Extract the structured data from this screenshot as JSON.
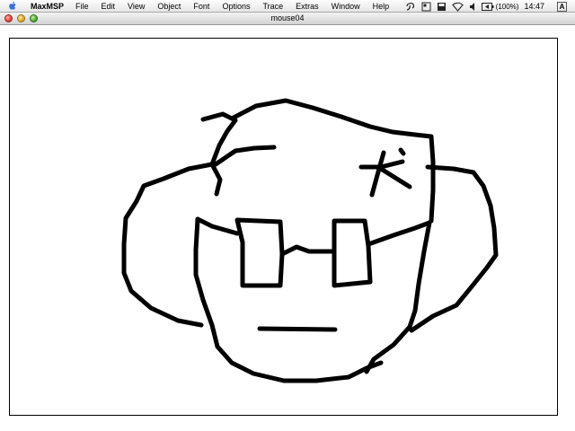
{
  "menubar": {
    "apple_icon": "apple-icon",
    "app_name": "MaxMSP",
    "menus": [
      "File",
      "Edit",
      "View",
      "Object",
      "Font",
      "Options",
      "Trace",
      "Extras",
      "Window",
      "Help"
    ],
    "battery_text": "(100%)",
    "clock": "14:47",
    "spotlight_letter": "A"
  },
  "window": {
    "title": "mouse04"
  }
}
